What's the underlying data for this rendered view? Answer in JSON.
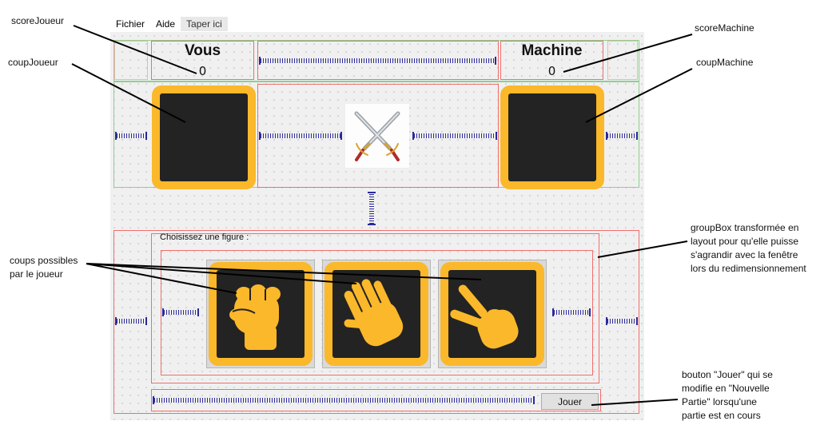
{
  "menu": {
    "items": [
      "Fichier",
      "Aide"
    ],
    "placeholder": "Taper ici"
  },
  "game": {
    "player_title": "Vous",
    "machine_title": "Machine",
    "player_score": "0",
    "machine_score": "0",
    "group_title": "Choisissez une figure :",
    "play_button": "Jouer",
    "moves": [
      "rock-fist-icon",
      "paper-hand-icon",
      "scissors-hand-icon"
    ],
    "center_icon": "crossed-swords-icon"
  },
  "annotations": {
    "score_joueur": "scoreJoueur",
    "coup_joueur": "coupJoueur",
    "score_machine": "scoreMachine",
    "coup_machine": "coupMachine",
    "coups_possibles": "coups possibles\npar le joueur",
    "groupbox_note": "groupBox transformée en\nlayout pour qu'elle puisse\ns'agrandir avec la fenêtre\nlors du redimensionnement",
    "bouton_note": "bouton \"Jouer\" qui se\nmodifie en \"Nouvelle\nPartie\" lorsqu'une\npartie est en cours"
  },
  "colors": {
    "tile_border": "#fbb82a",
    "tile_fill": "#232323",
    "layout_red": "#ef6f6f",
    "layout_green": "#8fcf8f",
    "spacer_blue": "#2a2a9a"
  }
}
